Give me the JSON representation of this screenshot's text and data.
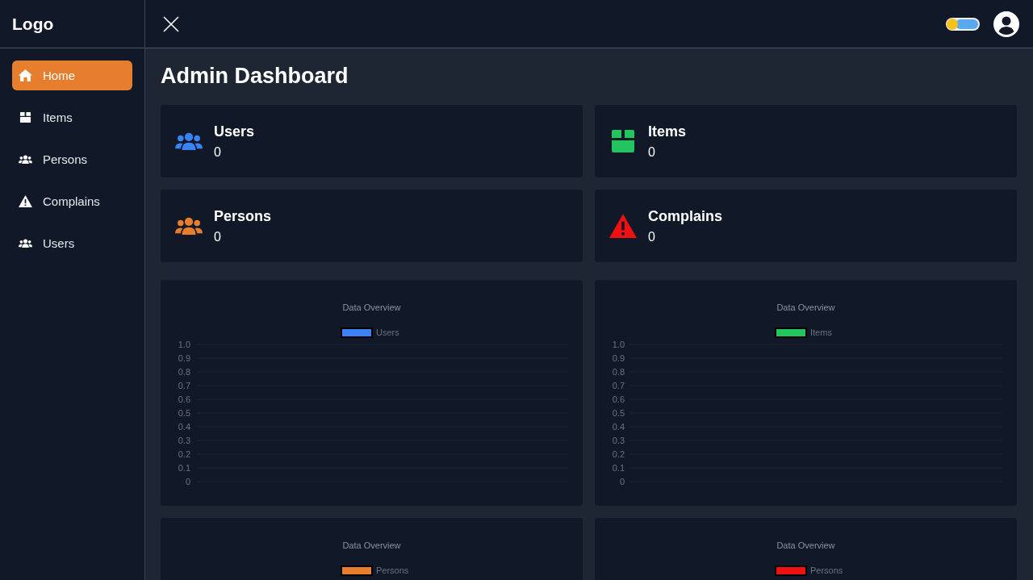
{
  "sidebar": {
    "logo": "Logo",
    "items": [
      {
        "label": "Home",
        "selected": true
      },
      {
        "label": "Items",
        "selected": false
      },
      {
        "label": "Persons",
        "selected": false
      },
      {
        "label": "Complains",
        "selected": false
      },
      {
        "label": "Users",
        "selected": false
      }
    ]
  },
  "page_title": "Admin Dashboard",
  "stats": [
    {
      "label": "Users",
      "value": "0",
      "color": "#3b82f6"
    },
    {
      "label": "Items",
      "value": "0",
      "color": "#22c55e"
    },
    {
      "label": "Persons",
      "value": "0",
      "color": "#e67e2e"
    },
    {
      "label": "Complains",
      "value": "0",
      "color": "#ef1111"
    }
  ],
  "charts": [
    {
      "chart_data": {
        "type": "bar",
        "title": "Data Overview",
        "grid": true,
        "series": [
          {
            "name": "Users",
            "color": "#3b82f6"
          }
        ],
        "ylim": [
          0,
          1
        ],
        "yticks": [
          0,
          0.1,
          0.2,
          0.3,
          0.4,
          0.5,
          0.6,
          0.7,
          0.8,
          0.9,
          {
            "value": 1,
            "label": "1.0"
          }
        ]
      }
    },
    {
      "chart_data": {
        "type": "bar",
        "title": "Data Overview",
        "grid": true,
        "series": [
          {
            "name": "Items",
            "color": "#22c55e"
          }
        ],
        "ylim": [
          0,
          1
        ],
        "yticks": [
          0,
          0.1,
          0.2,
          0.3,
          0.4,
          0.5,
          0.6,
          0.7,
          0.8,
          0.9,
          {
            "value": 1,
            "label": "1.0"
          }
        ]
      }
    },
    {
      "title": "Data Overview",
      "series": [
        {
          "name": "Persons",
          "color": "#e67e2e"
        }
      ]
    },
    {
      "title": "Data Overview",
      "series": [
        {
          "name": "Persons",
          "color": "#ef1111"
        }
      ]
    }
  ]
}
